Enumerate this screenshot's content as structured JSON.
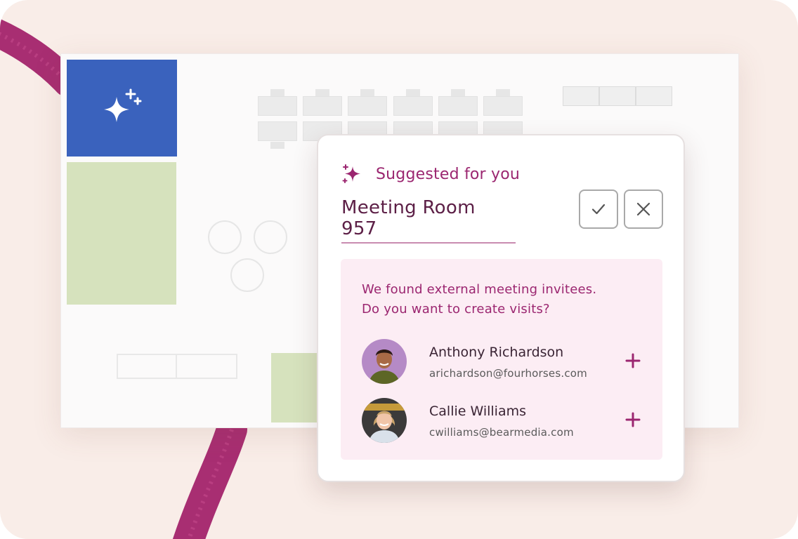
{
  "suggestion": {
    "label": "Suggested for you",
    "room_name": "Meeting Room 957",
    "accept_icon": "checkmark-icon",
    "dismiss_icon": "close-icon"
  },
  "invitees": {
    "message_line1": "We found external meeting invitees.",
    "message_line2": "Do you want to create visits?",
    "people": [
      {
        "name": "Anthony Richardson",
        "email": "arichardson@fourhorses.com"
      },
      {
        "name": "Callie Williams",
        "email": "cwilliams@bearmedia.com"
      }
    ]
  },
  "colors": {
    "accent": "#9b2670",
    "ai_tile": "#3a62bd",
    "room_green": "#d6e2bd",
    "background": "#f9ede8"
  }
}
